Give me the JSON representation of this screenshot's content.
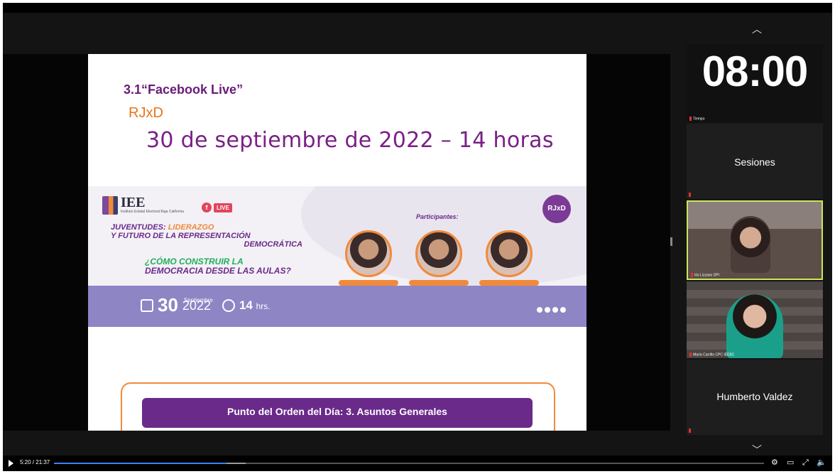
{
  "player": {
    "progress_fraction": 0.243,
    "buffered_fraction": 0.27,
    "timecode": "5:20 / 21:37"
  },
  "slide": {
    "heading": "3.1“Facebook Live”",
    "org": "RJxD",
    "date_line": "30 de septiembre de 2022 – 14 horas",
    "banner": {
      "iee_logo": "IEE",
      "iee_subtitle": "Instituto Estatal Electoral Baja California",
      "live_badge": "LIVE",
      "topic_line1_a": "JUVENTUDES:",
      "topic_line1_b": "LIDERAZGO",
      "topic_line2": "Y FUTURO DE LA REPRESENTACIÓN",
      "topic_line3": "DEMOCRÁTICA",
      "question_a": "¿CÓMO CONSTRUIR LA",
      "question_b": "DEMOCRACIA",
      "question_c": "DESDE LAS AULAS?",
      "participants_title": "Participantes:",
      "rjxd_logo": "RJxD",
      "day": "30",
      "month": "Septiembre",
      "year": "2022",
      "hour": "14",
      "hour_unit": "hrs."
    },
    "agenda_title": "Punto del Orden del Día: 3. Asuntos Generales"
  },
  "participants_panel": {
    "timer": "08:00",
    "timer_label": "Tiempo",
    "sessions_name": "Sesiones",
    "video1_label": "Iris Lizzano DPI",
    "video2_label": "María Carrillo CPC IEEBC",
    "humberto_name": "Humberto Valdez"
  },
  "icons": [
    "chevron-up-icon",
    "chevron-down-icon",
    "play-icon",
    "settings-icon",
    "miniplayer-icon",
    "fullscreen-icon",
    "volume-icon"
  ]
}
